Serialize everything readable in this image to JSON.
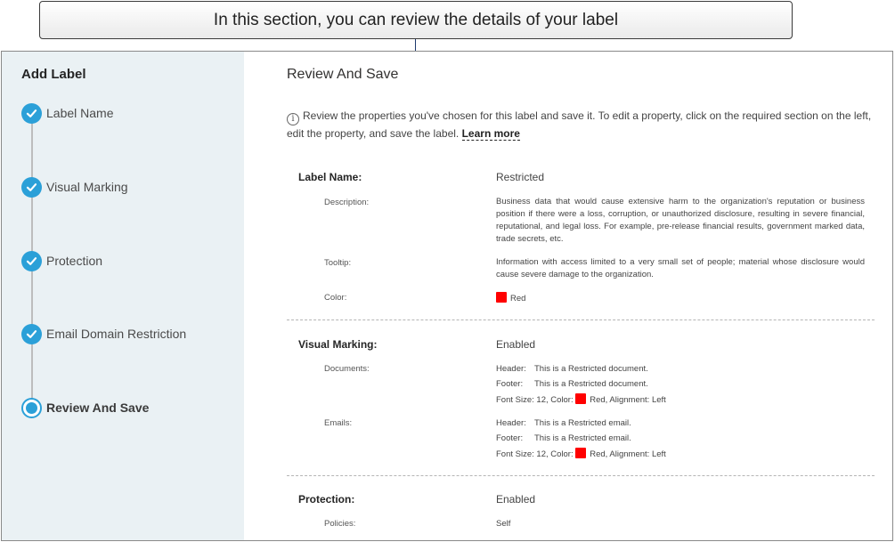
{
  "callout": {
    "text": "In this section, you can review the details of your label"
  },
  "sidebar": {
    "title": "Add Label",
    "steps": [
      {
        "label": "Label Name",
        "state": "done"
      },
      {
        "label": "Visual Marking",
        "state": "done"
      },
      {
        "label": "Protection",
        "state": "done"
      },
      {
        "label": "Email Domain Restriction",
        "state": "done"
      },
      {
        "label": "Review And Save",
        "state": "current"
      }
    ]
  },
  "main": {
    "title": "Review And Save",
    "info_text": "Review the properties you've chosen for this label and save it. To edit a property, click on the required section on the left, edit the property, and save the label.",
    "learn_more": "Learn more",
    "label_name": {
      "heading": "Label Name:",
      "value": "Restricted",
      "description_label": "Description:",
      "description": "Business data that would cause extensive harm to the organization's reputation or business position if there were a loss, corruption, or unauthorized disclosure, resulting in severe financial, reputational, and legal loss. For example, pre-release financial results, government marked data, trade secrets, etc.",
      "tooltip_label": "Tooltip:",
      "tooltip": "Information with access limited to a very small set of people; material whose disclosure would cause severe damage to the organization.",
      "color_label": "Color:",
      "color": "Red"
    },
    "visual_marking": {
      "heading": "Visual Marking:",
      "value": "Enabled",
      "documents_label": "Documents:",
      "documents": {
        "header_key": "Header:",
        "header": "This is a Restricted document.",
        "footer_key": "Footer:",
        "footer": "This is a Restricted document.",
        "format_prefix": "Font Size: 12,  Color:",
        "format_suffix": "Red, Alignment: Left"
      },
      "emails_label": "Emails:",
      "emails": {
        "header_key": "Header:",
        "header": "This is a Restricted email.",
        "footer_key": "Footer:",
        "footer": "This is a Restricted email.",
        "format_prefix": "Font Size: 12,  Color:",
        "format_suffix": "Red, Alignment: Left"
      }
    },
    "protection": {
      "heading": "Protection:",
      "value": "Enabled",
      "policies_label": "Policies:",
      "policies": "Self"
    }
  },
  "colors": {
    "accent": "#2ba0d8",
    "sidebar_bg": "#eaf1f4",
    "label_color": "#ff0000"
  }
}
